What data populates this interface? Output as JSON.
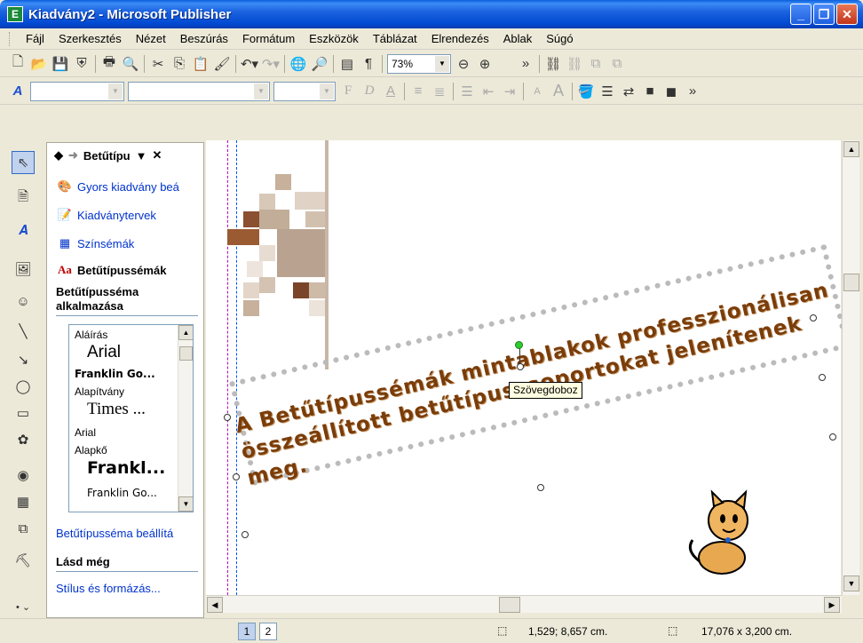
{
  "window": {
    "title": "Kiadvány2 - Microsoft Publisher",
    "app_icon_letter": "E"
  },
  "menu": [
    "Fájl",
    "Szerkesztés",
    "Nézet",
    "Beszúrás",
    "Formátum",
    "Eszközök",
    "Táblázat",
    "Elrendezés",
    "Ablak",
    "Súgó"
  ],
  "toolbar": {
    "zoom": "73%",
    "bold": "F",
    "italic": "D",
    "underline": "A"
  },
  "taskpane": {
    "title": "Betűtípu",
    "links": [
      "Gyors kiadvány beá",
      "Kiadványtervek",
      "Színsémák",
      "Betűtípussémák"
    ],
    "apply_heading_line1": "Betűtípusséma",
    "apply_heading_line2": "alkalmazása",
    "fontlist": [
      {
        "label": "Aláírás"
      },
      {
        "label": "Arial"
      },
      {
        "label": "Franklin Go..."
      },
      {
        "label": "Alapítvány"
      },
      {
        "label": "Times ..."
      },
      {
        "label": "Arial"
      },
      {
        "label": "Alapkő"
      },
      {
        "label": "Frankl..."
      },
      {
        "label": "Franklin Go..."
      }
    ],
    "settings_link": "Betűtípusséma beállítá",
    "see_also_heading": "Lásd még",
    "style_link": "Stílus és formázás..."
  },
  "document": {
    "body_text": "A Betűtípussémák mintablakok professzionálisan összeállított betűtípuscsoportokat jelenítenek meg.",
    "tooltip": "Szövegdoboz"
  },
  "statusbar": {
    "pages": [
      "1",
      "2"
    ],
    "position": "1,529; 8,657 cm.",
    "size": "17,076 x 3,200 cm."
  },
  "colors": {
    "titlebar": "#0a5fdc",
    "link": "#0033cc",
    "text_brown": "#7a3d0a"
  }
}
